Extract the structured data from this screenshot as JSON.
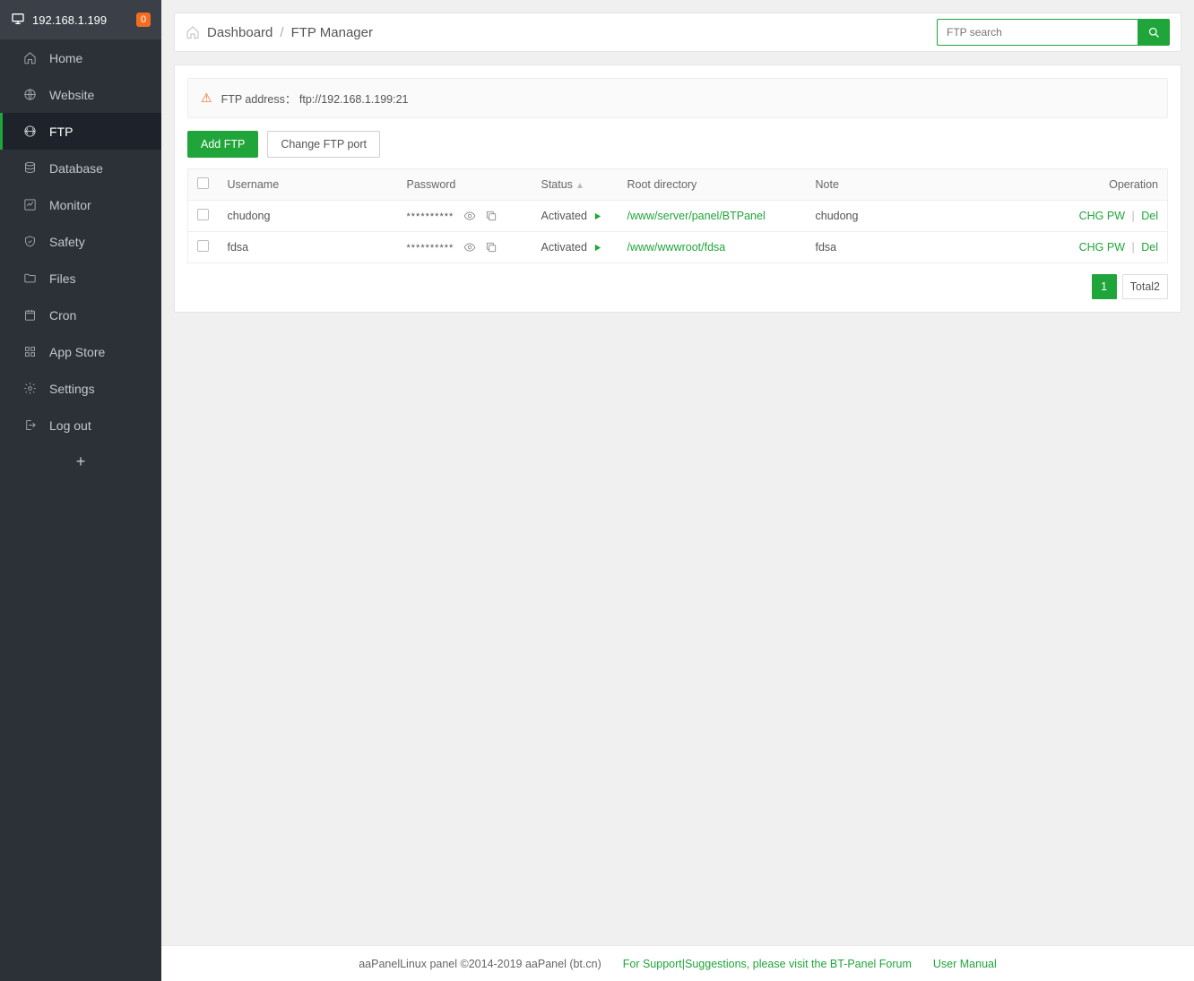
{
  "header": {
    "ip": "192.168.1.199",
    "badge": "0"
  },
  "sidebar": {
    "items": [
      {
        "id": "home",
        "label": "Home",
        "icon": "home-icon"
      },
      {
        "id": "website",
        "label": "Website",
        "icon": "globe-icon"
      },
      {
        "id": "ftp",
        "label": "FTP",
        "icon": "ftp-icon"
      },
      {
        "id": "database",
        "label": "Database",
        "icon": "database-icon"
      },
      {
        "id": "monitor",
        "label": "Monitor",
        "icon": "monitor-icon"
      },
      {
        "id": "safety",
        "label": "Safety",
        "icon": "shield-icon"
      },
      {
        "id": "files",
        "label": "Files",
        "icon": "folder-icon"
      },
      {
        "id": "cron",
        "label": "Cron",
        "icon": "calendar-icon"
      },
      {
        "id": "appstore",
        "label": "App Store",
        "icon": "grid-icon"
      },
      {
        "id": "settings",
        "label": "Settings",
        "icon": "gear-icon"
      },
      {
        "id": "logout",
        "label": "Log out",
        "icon": "logout-icon"
      }
    ],
    "active": "ftp",
    "add_icon": "plus-icon"
  },
  "breadcrumb": {
    "root": "Dashboard",
    "current": "FTP Manager"
  },
  "search": {
    "placeholder": "FTP search"
  },
  "notice": {
    "label": "FTP address：",
    "value": "ftp://192.168.1.199:21"
  },
  "buttons": {
    "add": "Add FTP",
    "change_port": "Change FTP port"
  },
  "table": {
    "columns": {
      "username": "Username",
      "password": "Password",
      "status": "Status",
      "root": "Root directory",
      "note": "Note",
      "operation": "Operation"
    },
    "rows": [
      {
        "username": "chudong",
        "password": "**********",
        "status": "Activated",
        "root": "/www/server/panel/BTPanel",
        "note": "chudong",
        "op_chg": "CHG PW",
        "op_del": "Del"
      },
      {
        "username": "fdsa",
        "password": "**********",
        "status": "Activated",
        "root": "/www/wwwroot/fdsa",
        "note": "fdsa",
        "op_chg": "CHG PW",
        "op_del": "Del"
      }
    ]
  },
  "pager": {
    "page": "1",
    "total_label": "Total2"
  },
  "footer": {
    "copyright": "aaPanelLinux panel ©2014-2019 aaPanel (bt.cn)",
    "support": "For Support|Suggestions, please visit the BT-Panel Forum",
    "manual": "User Manual"
  }
}
